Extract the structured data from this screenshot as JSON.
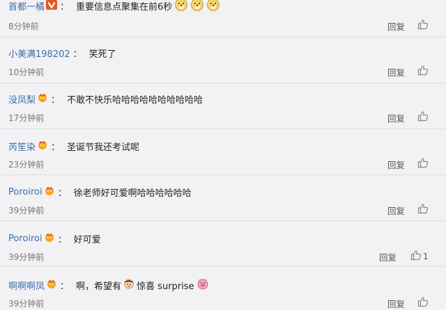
{
  "comments": [
    {
      "user": "首都一橘",
      "text": "重要信息点聚集在前6秒",
      "time": "8分钟前",
      "reply": "回复",
      "likes": ""
    },
    {
      "user": "小美满198202",
      "text": "笑死了",
      "time": "10分钟前",
      "reply": "回复",
      "likes": ""
    },
    {
      "user": "没凤梨",
      "text": "不敢不快乐哈哈哈哈哈哈哈哈哈哈",
      "time": "17分钟前",
      "reply": "回复",
      "likes": ""
    },
    {
      "user": "芮笙染",
      "text": "圣诞节我还考试呢",
      "time": "23分钟前",
      "reply": "回复",
      "likes": ""
    },
    {
      "user": "Poroiroi",
      "text": "徐老师好可爱啊哈哈哈哈哈哈",
      "time": "39分钟前",
      "reply": "回复",
      "likes": ""
    },
    {
      "user": "Poroiroi",
      "text": "好可爱",
      "time": "39分钟前",
      "reply": "回复",
      "likes": "1"
    },
    {
      "user": "啊啊啊凤",
      "text_parts": [
        "啊，希望有",
        "惊喜 surprise"
      ],
      "time": "39分钟前",
      "reply": "回复",
      "likes": ""
    }
  ],
  "colors": {
    "username": "#3c6ea8",
    "background": "#f2f2f5",
    "badge_vip": "#e8541e",
    "badge_crown": "#f5a623"
  },
  "icons": {
    "like": "thumbs-up-icon",
    "vip": "vip-badge-icon",
    "crown": "crown-badge-icon",
    "doge": "doge-emoji-icon"
  }
}
